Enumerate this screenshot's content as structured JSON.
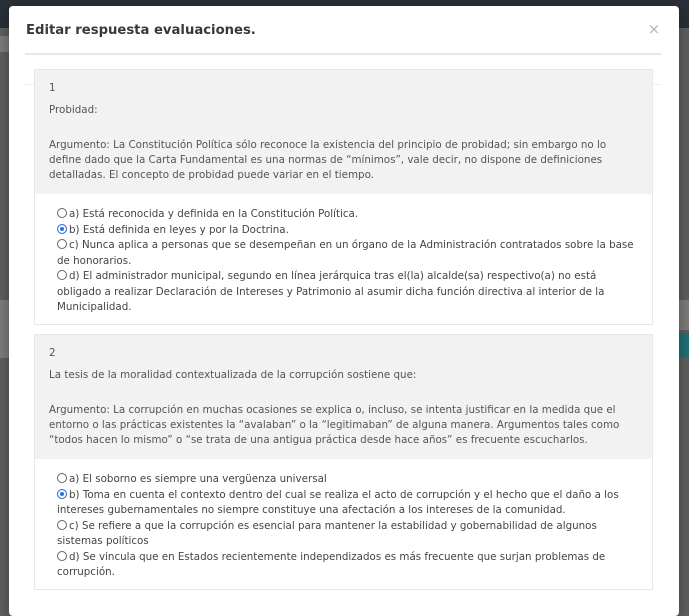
{
  "modal": {
    "title": "Editar respuesta evaluaciones.",
    "close_glyph": "×"
  },
  "questions": [
    {
      "number": "1",
      "text": "Probidad:",
      "argument": "Argumento: La Constitución Política sólo reconoce la existencia del principio de probidad; sin embargo no lo define dado que la Carta Fundamental es una normas de “mínimos”, vale decir, no dispone de definiciones detalladas. El concepto de probidad puede variar en el tiempo.",
      "options": [
        {
          "label": "a) Está reconocida y definida en la Constitución Política.",
          "selected": false
        },
        {
          "label": "b) Está definida en leyes y por la Doctrina.",
          "selected": true
        },
        {
          "label": "c) Nunca aplica a personas que se desempeñan en un órgano de la Administración contratados sobre la base de honorarios.",
          "selected": false
        },
        {
          "label": "d) El administrador municipal, segundo en línea jerárquica tras el(la) alcalde(sa) respectivo(a) no está obligado a realizar Declaración de Intereses y Patrimonio al asumir dicha función directiva al interior de la Municipalidad.",
          "selected": false
        }
      ]
    },
    {
      "number": "2",
      "text": "La tesis de la moralidad contextualizada de la corrupción sostiene que:",
      "argument": "Argumento: La corrupción en muchas ocasiones se explica o, incluso, se intenta justificar en la medida que el entorno o las prácticas existentes la “avalaban” o la “legitimaban” de alguna manera. Argumentos tales como “todos hacen lo mismo” o “se trata de una antigua práctica desde hace años” es frecuente escucharlos.",
      "options": [
        {
          "label": "a) El soborno es siempre una vergüenza universal",
          "selected": false
        },
        {
          "label": "b) Toma en cuenta el contexto dentro del cual se realiza el acto de corrupción y el hecho que el daño a los intereses gubernamentales no siempre constituye una afectación a los intereses de la comunidad.",
          "selected": true
        },
        {
          "label": "c) Se refiere a que la corrupción es esencial para mantener la estabilidad y gobernabilidad de algunos sistemas políticos",
          "selected": false
        },
        {
          "label": "d) Se vincula que en Estados recientemente independizados es más frecuente que surjan problemas de corrupción.",
          "selected": false
        }
      ]
    }
  ],
  "colors": {
    "radio_selected": "#2c6fd8",
    "question_header_bg": "#f2f2f2",
    "backdrop": "#5e5e5e"
  }
}
